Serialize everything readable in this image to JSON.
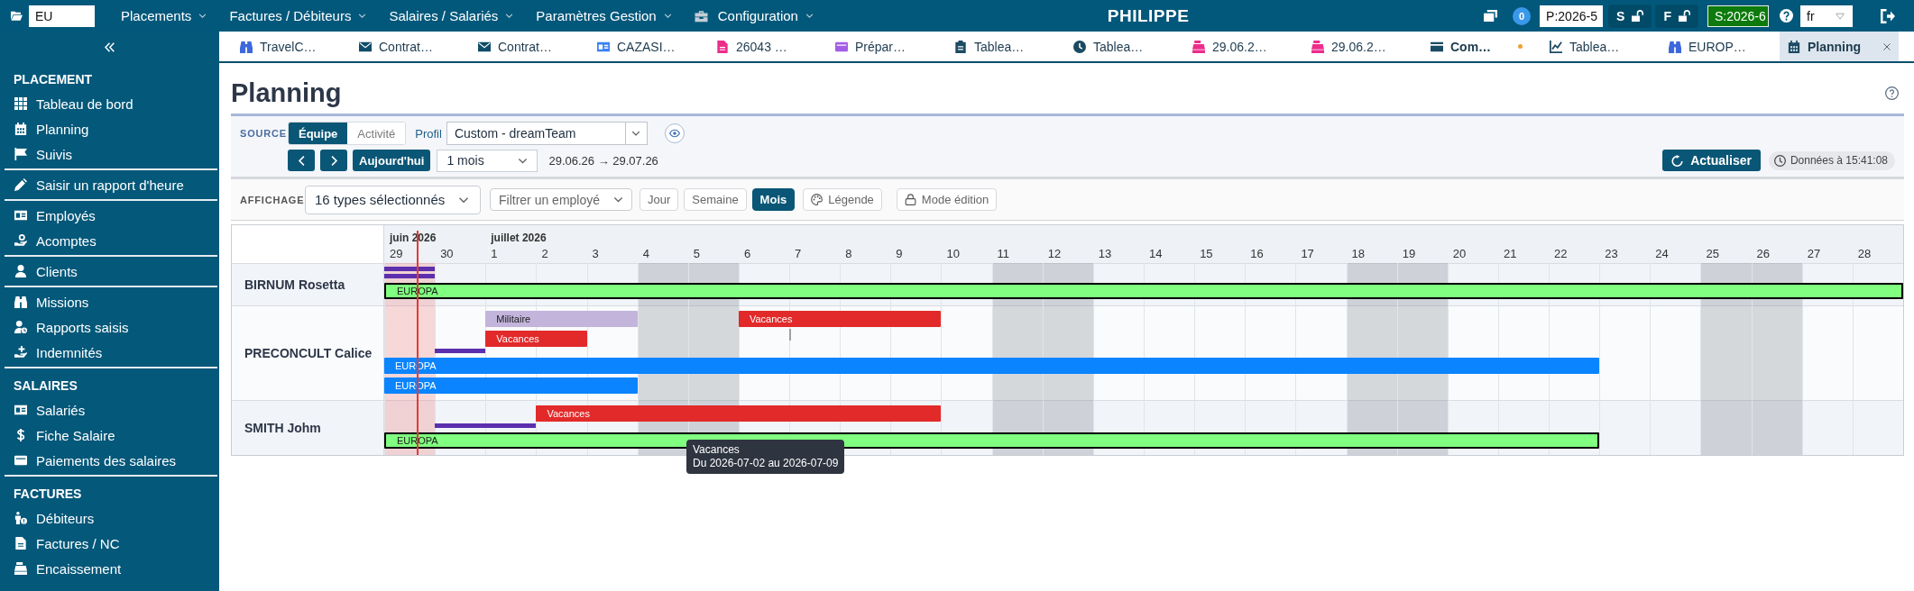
{
  "top_bar": {
    "company_field": {
      "value": "EU"
    },
    "menus": [
      {
        "label": "Placements",
        "kind": "plain"
      },
      {
        "label": "Factures / Débiteurs",
        "kind": "plain"
      },
      {
        "label": "Salaires / Salariés",
        "kind": "plain"
      },
      {
        "label": "Paramètres Gestion",
        "kind": "plain"
      },
      {
        "label": "Configuration",
        "kind": "toolbox"
      }
    ],
    "user": "PHILIPPE",
    "notification_count": "0",
    "period_field": {
      "value": "P:2026-5"
    },
    "locks": [
      {
        "label": "S",
        "locked": false
      },
      {
        "label": "F",
        "locked": false
      }
    ],
    "session_field": {
      "value": "S:2026-6"
    },
    "language_select": {
      "value": "fr"
    }
  },
  "sidebar": {
    "sections": [
      {
        "heading": "PLACEMENT",
        "groups": [
          [
            {
              "label": "Tableau de bord",
              "kind": "grid",
              "selected": false
            },
            {
              "label": "Planning",
              "kind": "calendar",
              "selected": false
            },
            {
              "label": "Suivis",
              "kind": "flag",
              "selected": false
            }
          ],
          [
            {
              "label": "Saisir un rapport d'heure",
              "kind": "pencil",
              "selected": false
            }
          ],
          [
            {
              "label": "Employés",
              "kind": "id-card",
              "selected": false
            },
            {
              "label": "Acomptes",
              "kind": "hand-coin",
              "selected": false
            }
          ],
          [
            {
              "label": "Clients",
              "kind": "user",
              "selected": false
            }
          ],
          [
            {
              "label": "Missions",
              "kind": "binoculars",
              "selected": false
            },
            {
              "label": "Rapports saisis",
              "kind": "user-clock",
              "selected": false
            },
            {
              "label": "Indemnités",
              "kind": "hand-plus",
              "selected": false
            }
          ]
        ]
      },
      {
        "heading": "SALAIRES",
        "groups": [
          [
            {
              "label": "Salariés",
              "kind": "id-card",
              "selected": false
            },
            {
              "label": "Fiche Salaire",
              "kind": "dollar",
              "selected": false
            },
            {
              "label": "Paiements des salaires",
              "kind": "wallet",
              "selected": false
            }
          ]
        ]
      },
      {
        "heading": "FACTURES",
        "groups": [
          [
            {
              "label": "Débiteurs",
              "kind": "person-alert",
              "selected": false
            },
            {
              "label": "Factures / NC",
              "kind": "invoice",
              "selected": false
            },
            {
              "label": "Encaissement",
              "kind": "register",
              "selected": false
            }
          ]
        ]
      }
    ]
  },
  "tabs": [
    {
      "label": "TravelC…",
      "kind": "binoculars",
      "selected": false,
      "modified": false
    },
    {
      "label": "Contrat…",
      "kind": "envelope",
      "selected": false,
      "modified": false
    },
    {
      "label": "Contrat…",
      "kind": "envelope",
      "selected": false,
      "modified": false
    },
    {
      "label": "CAZASI…",
      "kind": "id-card",
      "selected": false,
      "modified": false
    },
    {
      "label": "26043 …",
      "kind": "invoice",
      "selected": false,
      "modified": false
    },
    {
      "label": "Prépar…",
      "kind": "wallet",
      "selected": false,
      "modified": false
    },
    {
      "label": "Tablea…",
      "kind": "clipboard",
      "selected": false,
      "modified": false
    },
    {
      "label": "Tablea…",
      "kind": "clock",
      "selected": false,
      "modified": false
    },
    {
      "label": "29.06.2…",
      "kind": "register",
      "selected": false,
      "modified": false
    },
    {
      "label": "29.06.2…",
      "kind": "register",
      "selected": false,
      "modified": false
    },
    {
      "label": "Com…",
      "kind": "card",
      "selected": false,
      "modified": true
    },
    {
      "label": "Tablea…",
      "kind": "chart",
      "selected": false,
      "modified": false
    },
    {
      "label": "EUROP…",
      "kind": "binoculars",
      "selected": false,
      "modified": false
    },
    {
      "label": "Planning",
      "kind": "calendar",
      "selected": true,
      "modified": false
    }
  ],
  "page": {
    "title": "Planning"
  },
  "source_bar": {
    "label": "SOURCE",
    "modes": [
      {
        "label": "Équipe",
        "selected": true
      },
      {
        "label": "Activité",
        "selected": false
      }
    ],
    "profile_label": "Profil",
    "profile_select": {
      "value": "Custom - dreamTeam"
    },
    "today_button": "Aujourd'hui",
    "period_select": {
      "value": "1 mois"
    },
    "date_range": "29.06.26 → 29.07.26",
    "refresh_button": "Actualiser",
    "updated": "Données à 15:41:08"
  },
  "display_bar": {
    "label": "AFFICHAGE",
    "types_select": {
      "value": "16 types sélectionnés"
    },
    "employee_filter": {
      "placeholder": "Filtrer un employé"
    },
    "views": [
      {
        "label": "Jour",
        "selected": false
      },
      {
        "label": "Semaine",
        "selected": false
      },
      {
        "label": "Mois",
        "selected": true
      }
    ],
    "legend_button": "Légende",
    "edit_mode_button": "Mode édition"
  },
  "gantt": {
    "months": [
      {
        "label": "juin 2026",
        "days": [
          {
            "label": "29",
            "weekend": false,
            "today": true
          },
          {
            "label": "30",
            "weekend": false,
            "today": false
          }
        ]
      },
      {
        "label": "juillet 2026",
        "days": [
          {
            "label": "1",
            "weekend": false,
            "today": false
          },
          {
            "label": "2",
            "weekend": false,
            "today": false
          },
          {
            "label": "3",
            "weekend": false,
            "today": false
          },
          {
            "label": "4",
            "weekend": true,
            "today": false
          },
          {
            "label": "5",
            "weekend": true,
            "today": false
          },
          {
            "label": "6",
            "weekend": false,
            "today": false
          },
          {
            "label": "7",
            "weekend": false,
            "today": false
          },
          {
            "label": "8",
            "weekend": false,
            "today": false
          },
          {
            "label": "9",
            "weekend": false,
            "today": false
          },
          {
            "label": "10",
            "weekend": false,
            "today": false
          },
          {
            "label": "11",
            "weekend": true,
            "today": false
          },
          {
            "label": "12",
            "weekend": true,
            "today": false
          },
          {
            "label": "13",
            "weekend": false,
            "today": false
          },
          {
            "label": "14",
            "weekend": false,
            "today": false
          },
          {
            "label": "15",
            "weekend": false,
            "today": false
          },
          {
            "label": "16",
            "weekend": false,
            "today": false
          },
          {
            "label": "17",
            "weekend": false,
            "today": false
          },
          {
            "label": "18",
            "weekend": true,
            "today": false
          },
          {
            "label": "19",
            "weekend": true,
            "today": false
          },
          {
            "label": "20",
            "weekend": false,
            "today": false
          },
          {
            "label": "21",
            "weekend": false,
            "today": false
          },
          {
            "label": "22",
            "weekend": false,
            "today": false
          },
          {
            "label": "23",
            "weekend": false,
            "today": false
          },
          {
            "label": "24",
            "weekend": false,
            "today": false
          },
          {
            "label": "25",
            "weekend": true,
            "today": false
          },
          {
            "label": "26",
            "weekend": true,
            "today": false
          },
          {
            "label": "27",
            "weekend": false,
            "today": false
          },
          {
            "label": "28",
            "weekend": false,
            "today": false
          }
        ]
      }
    ],
    "rows": [
      {
        "name": "BIRNUM Rosetta",
        "lanes": [
          [
            {
              "kind": "line",
              "color": "#5b2fae",
              "outlined": false
            }
          ],
          [
            {
              "kind": "line",
              "color": "#5b2fae",
              "outlined": false
            }
          ],
          [
            {
              "kind": "bar",
              "label": "EUROPA",
              "color": "#80ff80",
              "outlined": true
            },
            {
              "kind": "span"
            },
            {
              "kind": "span"
            },
            {
              "kind": "span"
            },
            {
              "kind": "span"
            },
            {
              "kind": "span"
            },
            {
              "kind": "span"
            },
            {
              "kind": "span"
            },
            {
              "kind": "span"
            },
            {
              "kind": "span"
            },
            {
              "kind": "span"
            },
            {
              "kind": "span"
            },
            {
              "kind": "span"
            },
            {
              "kind": "span"
            },
            {
              "kind": "span"
            },
            {
              "kind": "span"
            },
            {
              "kind": "span"
            },
            {
              "kind": "span"
            },
            {
              "kind": "span"
            },
            {
              "kind": "span"
            },
            {
              "kind": "span"
            },
            {
              "kind": "span"
            },
            {
              "kind": "span"
            },
            {
              "kind": "span"
            },
            {
              "kind": "span"
            },
            {
              "kind": "span"
            },
            {
              "kind": "span"
            },
            {
              "kind": "span"
            },
            {
              "kind": "span"
            },
            {
              "kind": "span"
            }
          ]
        ]
      },
      {
        "name": "PRECONCULT Calice",
        "lanes": [
          [
            {
              "kind": "empty"
            },
            {
              "kind": "empty"
            },
            {
              "kind": "bar",
              "label": "Militaire",
              "color": "#c3b4dc",
              "outlined": false
            },
            {
              "kind": "span"
            },
            {
              "kind": "span"
            },
            {
              "kind": "empty"
            },
            {
              "kind": "empty"
            },
            {
              "kind": "bar",
              "label": "Vacances",
              "color": "#e22a2a",
              "outlined": false
            },
            {
              "kind": "span"
            },
            {
              "kind": "span"
            },
            {
              "kind": "span"
            }
          ],
          [
            {
              "kind": "empty"
            },
            {
              "kind": "empty"
            },
            {
              "kind": "bar",
              "label": "Vacances",
              "color": "#e22a2a",
              "outlined": false
            },
            {
              "kind": "span"
            },
            {
              "kind": "empty"
            },
            {
              "kind": "empty"
            },
            {
              "kind": "empty"
            },
            {
              "kind": "empty"
            },
            {
              "kind": "tick",
              "color": "#9aa0a6"
            }
          ],
          [
            {
              "kind": "empty"
            },
            {
              "kind": "line",
              "color": "#5b2fae",
              "outlined": false
            }
          ],
          [
            {
              "kind": "bar",
              "label": "EUROPA",
              "color": "#0a84ff",
              "outlined": false
            },
            {
              "kind": "span"
            },
            {
              "kind": "span"
            },
            {
              "kind": "span"
            },
            {
              "kind": "span"
            },
            {
              "kind": "span"
            },
            {
              "kind": "span"
            },
            {
              "kind": "span"
            },
            {
              "kind": "span"
            },
            {
              "kind": "span"
            },
            {
              "kind": "span"
            },
            {
              "kind": "span"
            },
            {
              "kind": "span"
            },
            {
              "kind": "span"
            },
            {
              "kind": "span"
            },
            {
              "kind": "span"
            },
            {
              "kind": "span"
            },
            {
              "kind": "span"
            },
            {
              "kind": "span"
            },
            {
              "kind": "span"
            },
            {
              "kind": "span"
            },
            {
              "kind": "span"
            },
            {
              "kind": "span"
            },
            {
              "kind": "span"
            }
          ],
          [
            {
              "kind": "bar",
              "label": "EUROPA",
              "color": "#0a84ff",
              "outlined": false
            },
            {
              "kind": "span"
            },
            {
              "kind": "span"
            },
            {
              "kind": "span"
            },
            {
              "kind": "span"
            }
          ]
        ]
      },
      {
        "name": "SMITH Johm",
        "lanes": [
          [
            {
              "kind": "empty"
            },
            {
              "kind": "empty"
            },
            {
              "kind": "empty"
            },
            {
              "kind": "bar",
              "label": "Vacances",
              "color": "#e22a2a",
              "outlined": false
            },
            {
              "kind": "span"
            },
            {
              "kind": "span"
            },
            {
              "kind": "span"
            },
            {
              "kind": "span"
            },
            {
              "kind": "span"
            },
            {
              "kind": "span"
            },
            {
              "kind": "span"
            }
          ],
          [
            {
              "kind": "empty"
            },
            {
              "kind": "line",
              "color": "#5b2fae",
              "outlined": false
            },
            {
              "kind": "span"
            }
          ],
          [
            {
              "kind": "bar",
              "label": "EUROPA",
              "color": "#80ff80",
              "outlined": true
            },
            {
              "kind": "span"
            },
            {
              "kind": "span"
            },
            {
              "kind": "span"
            },
            {
              "kind": "span"
            },
            {
              "kind": "span"
            },
            {
              "kind": "span"
            },
            {
              "kind": "span"
            },
            {
              "kind": "span"
            },
            {
              "kind": "span"
            },
            {
              "kind": "span"
            },
            {
              "kind": "span"
            },
            {
              "kind": "span"
            },
            {
              "kind": "span"
            },
            {
              "kind": "span"
            },
            {
              "kind": "span"
            },
            {
              "kind": "span"
            },
            {
              "kind": "span"
            },
            {
              "kind": "span"
            },
            {
              "kind": "span"
            },
            {
              "kind": "span"
            },
            {
              "kind": "span"
            },
            {
              "kind": "span"
            },
            {
              "kind": "span"
            }
          ]
        ]
      }
    ],
    "tooltip": {
      "title": "Vacances",
      "text": "Du 2026-07-02 au 2026-07-09"
    }
  }
}
